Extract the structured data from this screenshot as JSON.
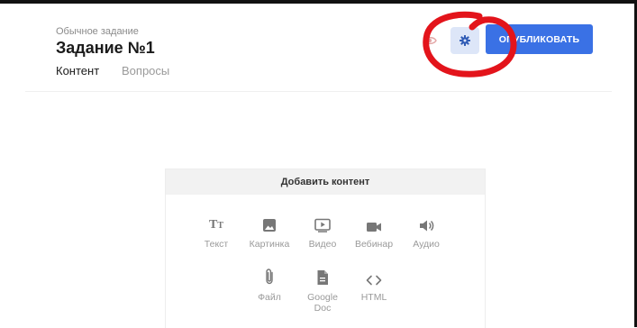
{
  "header": {
    "kicker": "Обычное задание",
    "title": "Задание №1",
    "tabs": [
      {
        "label": "Контент",
        "active": true
      },
      {
        "label": "Вопросы",
        "active": false
      }
    ]
  },
  "actions": {
    "preview_icon": "eye-icon",
    "settings_icon": "gear-icon",
    "publish_label": "ОПУБЛИКОВАТЬ"
  },
  "content_panel": {
    "title": "Добавить контент",
    "items": [
      {
        "label": "Текст",
        "icon": "text-icon"
      },
      {
        "label": "Картинка",
        "icon": "image-icon"
      },
      {
        "label": "Видео",
        "icon": "video-icon"
      },
      {
        "label": "Вебинар",
        "icon": "webinar-icon"
      },
      {
        "label": "Аудио",
        "icon": "audio-icon"
      },
      {
        "label": "Файл",
        "icon": "paperclip-icon"
      },
      {
        "label": "Google Doc",
        "icon": "document-icon"
      },
      {
        "label": "HTML",
        "icon": "code-icon"
      }
    ]
  },
  "colors": {
    "accent": "#3a71e5",
    "settings_bg": "#dde6f8",
    "annotation": "#e3141b",
    "muted": "#9a9a9a",
    "icon_gray": "#777777"
  }
}
